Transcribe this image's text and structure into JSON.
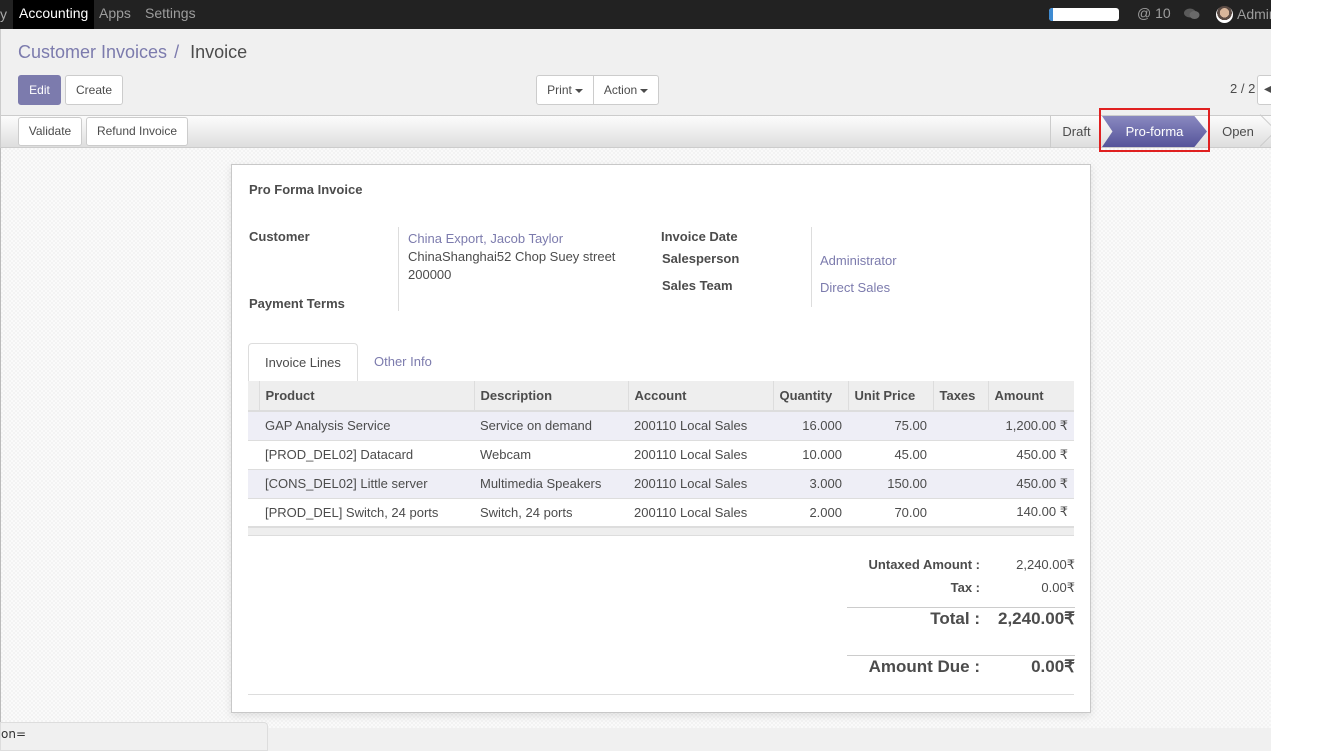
{
  "topbar": {
    "menu_fragment": "y",
    "menu": [
      {
        "label": "Accounting",
        "active": true
      },
      {
        "label": "Apps",
        "active": false
      },
      {
        "label": "Settings",
        "active": false
      }
    ],
    "progress_percent": 5,
    "mentions": "@ 10",
    "user_name": "Admin"
  },
  "breadcrumb": {
    "parent": "Customer Invoices",
    "separator": "/",
    "current": "Invoice"
  },
  "toolbar": {
    "edit_label": "Edit",
    "create_label": "Create",
    "print_label": "Print",
    "action_label": "Action",
    "pager": "2 / 2",
    "pager_prev": "◀"
  },
  "statusbar": {
    "validate_label": "Validate",
    "refund_label": "Refund Invoice",
    "stages": [
      "Draft",
      "Pro-forma",
      "Open"
    ],
    "active_stage": "Pro-forma"
  },
  "invoice": {
    "title": "Pro Forma Invoice",
    "labels": {
      "customer": "Customer",
      "payment_terms": "Payment Terms",
      "invoice_date": "Invoice Date",
      "salesperson": "Salesperson",
      "sales_team": "Sales Team"
    },
    "customer_name": "China Export, Jacob Taylor",
    "customer_address_line1": "ChinaShanghai52 Chop Suey street",
    "customer_address_line2": "200000",
    "payment_terms": "",
    "invoice_date": "",
    "salesperson": "Administrator",
    "sales_team": "Direct Sales"
  },
  "tabs": [
    {
      "label": "Invoice Lines",
      "active": true
    },
    {
      "label": "Other Info",
      "active": false
    }
  ],
  "lines": {
    "columns": [
      "Product",
      "Description",
      "Account",
      "Quantity",
      "Unit Price",
      "Taxes",
      "Amount"
    ],
    "rows": [
      {
        "product": "GAP Analysis Service",
        "description": "Service on demand",
        "account": "200110 Local Sales",
        "quantity": "16.000",
        "unit_price": "75.00",
        "taxes": "",
        "amount": "1,200.00 ₹"
      },
      {
        "product": "[PROD_DEL02] Datacard",
        "description": "Webcam",
        "account": "200110 Local Sales",
        "quantity": "10.000",
        "unit_price": "45.00",
        "taxes": "",
        "amount": "450.00 ₹"
      },
      {
        "product": "[CONS_DEL02] Little server",
        "description": "Multimedia Speakers",
        "account": "200110 Local Sales",
        "quantity": "3.000",
        "unit_price": "150.00",
        "taxes": "",
        "amount": "450.00 ₹"
      },
      {
        "product": "[PROD_DEL] Switch, 24 ports",
        "description": "Switch, 24 ports",
        "account": "200110 Local Sales",
        "quantity": "2.000",
        "unit_price": "70.00",
        "taxes": "",
        "amount": "140.00 ₹"
      }
    ]
  },
  "totals": {
    "untaxed_label": "Untaxed Amount :",
    "untaxed_value": "2,240.00₹",
    "tax_label": "Tax :",
    "tax_value": "0.00₹",
    "total_label": "Total :",
    "total_value": "2,240.00₹",
    "due_label": "Amount Due :",
    "due_value": "0.00₹"
  },
  "status_url": "on=",
  "colors": {
    "accent": "#7c7bad",
    "topbar": "#222222",
    "highlight": "#e02020"
  }
}
